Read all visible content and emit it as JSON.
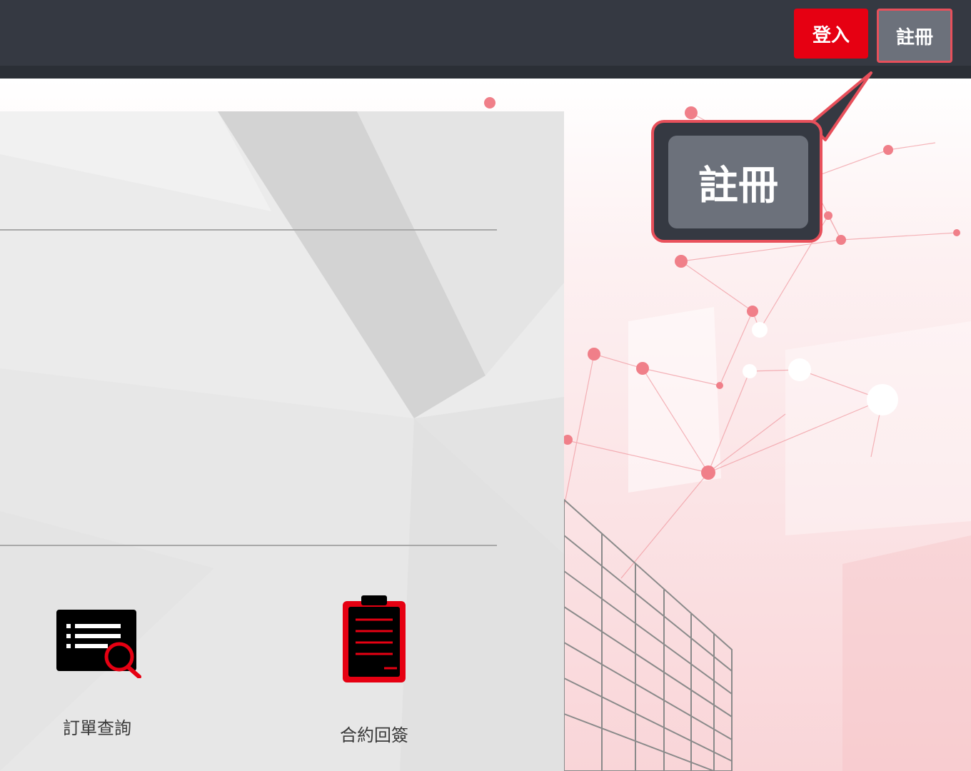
{
  "header": {
    "login_label": "登入",
    "register_label": "註冊"
  },
  "shortcuts": [
    {
      "label": "訂單查詢",
      "icon": "order-search-icon"
    },
    {
      "label": "合約回簽",
      "icon": "clipboard-icon"
    }
  ],
  "callout": {
    "label": "註冊"
  },
  "colors": {
    "header_bg": "#353942",
    "login_bg": "#e60012",
    "register_bg": "#6c717b",
    "highlight": "#e8505b",
    "icon_red": "#e60012",
    "icon_black": "#000000"
  }
}
